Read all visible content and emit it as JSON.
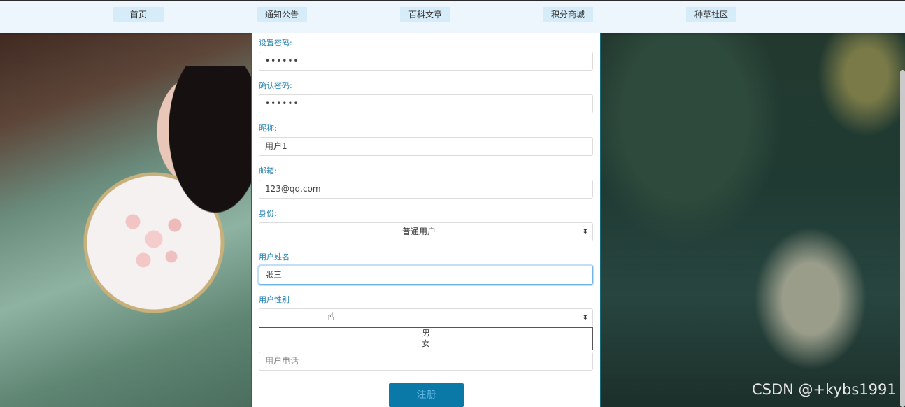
{
  "nav": {
    "items": [
      {
        "label": "首页"
      },
      {
        "label": "通知公告"
      },
      {
        "label": "百科文章"
      },
      {
        "label": "积分商城"
      },
      {
        "label": "种草社区"
      }
    ]
  },
  "form": {
    "password_label": "设置密码:",
    "password_value": "••••••",
    "confirm_label": "确认密码:",
    "confirm_value": "••••••",
    "nickname_label": "昵称:",
    "nickname_value": "用户1",
    "email_label": "邮箱:",
    "email_value": "123@qq.com",
    "identity_label": "身份:",
    "identity_selected": "普通用户",
    "username_label": "用户姓名",
    "username_value": "张三",
    "gender_label": "用户性别",
    "gender_selected": "",
    "gender_options": [
      "男",
      "女"
    ],
    "phone_placeholder": "用户电话",
    "submit_label": "注册"
  },
  "icons": {
    "select_arrow": "sort-arrows-icon",
    "cursor": "hand-pointer-icon"
  },
  "watermark": "CSDN @+kybs1991",
  "colors": {
    "accent": "#0b79a7",
    "label": "#1f7fae",
    "nav_bg": "#edf6fd"
  }
}
